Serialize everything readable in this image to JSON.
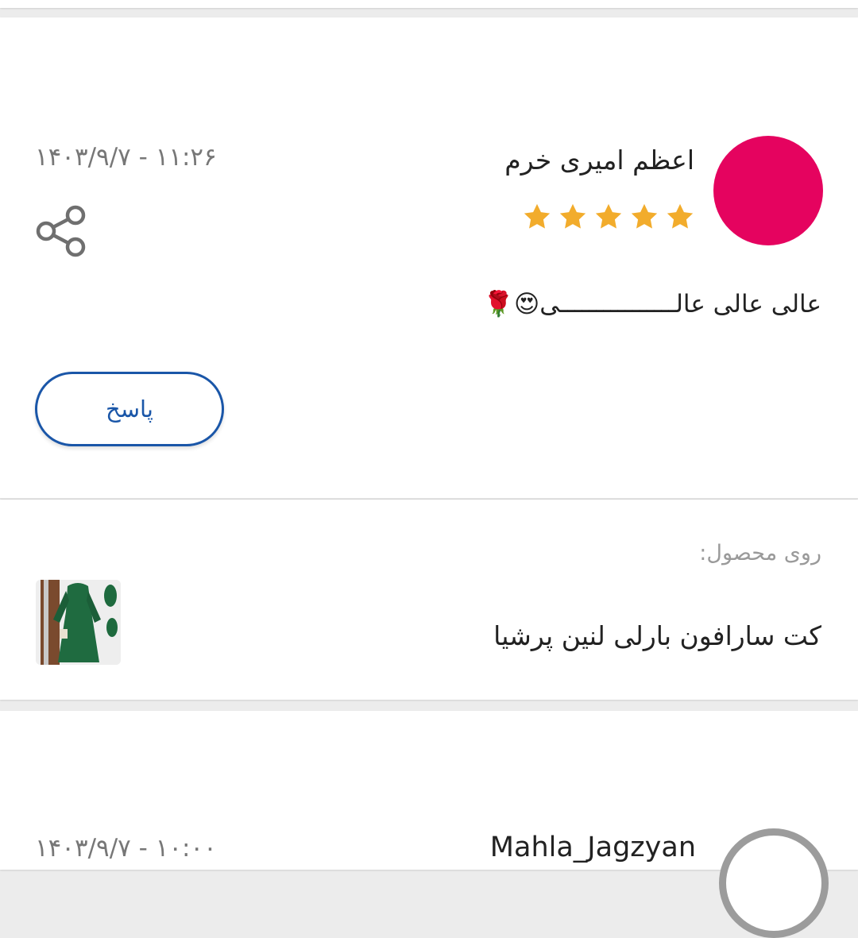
{
  "review": {
    "reviewer_name": "اعظم امیری خرم",
    "rating": 5,
    "rating_max": 5,
    "date": "۱۴۰۳/۹/۷ - ۱۱:۲۶",
    "comment": "عالی عالی عالــــــــــــــــی😍🌹",
    "reply_label": "پاسخ",
    "share_icon": "share-icon",
    "avatar_color": "#e5035f",
    "star_color": "#f2ac2c"
  },
  "product": {
    "label": "روی محصول:",
    "name": "کت سارافون بارلی لنین پرشیا"
  },
  "next_review": {
    "reviewer_name": "Mahla_Jagzyan",
    "date": "۱۴۰۳/۹/۷ - ۱۰:۰۰"
  },
  "accent_color": "#1a56a8"
}
